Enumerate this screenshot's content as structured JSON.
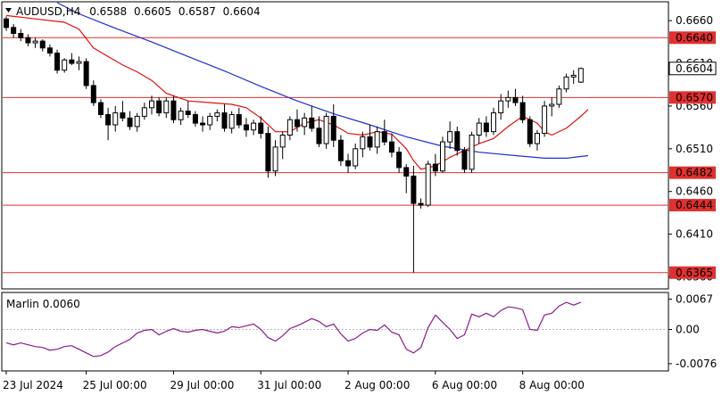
{
  "chart_data": {
    "type": "candlestick",
    "header": {
      "symbol": "AUDUSD,H4",
      "open": "0.6588",
      "high": "0.6605",
      "low": "0.6587",
      "close": "0.6604"
    },
    "price_axis": {
      "ylim": [
        0.6347,
        0.6681
      ],
      "ticks": [
        "0.6660",
        "0.6610",
        "0.6560",
        "0.6510",
        "0.6460",
        "0.6410",
        "0.6360"
      ]
    },
    "levels": [
      {
        "label": "0.6640",
        "value": 0.664
      },
      {
        "label": "0.6570",
        "value": 0.657
      },
      {
        "label": "0.6482",
        "value": 0.6482
      },
      {
        "label": "0.6444",
        "value": 0.6444
      },
      {
        "label": "0.6365",
        "value": 0.6365
      }
    ],
    "current_price": {
      "label": "0.6604",
      "value": 0.6604
    },
    "time_axis": {
      "labels": [
        {
          "text": "23 Jul 2024",
          "bar": 0
        },
        {
          "text": "25 Jul 00:00",
          "bar": 11
        },
        {
          "text": "29 Jul 00:00",
          "bar": 23
        },
        {
          "text": "31 Jul 00:00",
          "bar": 35
        },
        {
          "text": "2 Aug 00:00",
          "bar": 47
        },
        {
          "text": "6 Aug 00:00",
          "bar": 59
        },
        {
          "text": "8 Aug 00:00",
          "bar": 71
        }
      ]
    },
    "series_colors": {
      "bull": "#ffffff",
      "bear": "#000000",
      "wick": "#000000"
    },
    "candles": [
      [
        0.6662,
        0.6665,
        0.6648,
        0.6652
      ],
      [
        0.6652,
        0.6656,
        0.664,
        0.6645
      ],
      [
        0.6645,
        0.665,
        0.6636,
        0.664
      ],
      [
        0.664,
        0.6644,
        0.663,
        0.6634
      ],
      [
        0.6634,
        0.664,
        0.6628,
        0.6636
      ],
      [
        0.6636,
        0.6638,
        0.6624,
        0.6628
      ],
      [
        0.6628,
        0.6632,
        0.6618,
        0.6622
      ],
      [
        0.6622,
        0.6626,
        0.6598,
        0.6602
      ],
      [
        0.6602,
        0.6616,
        0.6599,
        0.6614
      ],
      [
        0.6614,
        0.6622,
        0.6608,
        0.661
      ],
      [
        0.661,
        0.6618,
        0.6602,
        0.6612
      ],
      [
        0.6612,
        0.6616,
        0.658,
        0.6584
      ],
      [
        0.6584,
        0.659,
        0.656,
        0.6564
      ],
      [
        0.6564,
        0.6568,
        0.6546,
        0.655
      ],
      [
        0.655,
        0.6558,
        0.652,
        0.6538
      ],
      [
        0.6538,
        0.656,
        0.653,
        0.6552
      ],
      [
        0.6552,
        0.6566,
        0.6542,
        0.6546
      ],
      [
        0.6546,
        0.6554,
        0.6532,
        0.6536
      ],
      [
        0.6536,
        0.6552,
        0.653,
        0.6548
      ],
      [
        0.6548,
        0.6564,
        0.6544,
        0.6558
      ],
      [
        0.6558,
        0.6572,
        0.655,
        0.6566
      ],
      [
        0.6566,
        0.657,
        0.6548,
        0.6552
      ],
      [
        0.6552,
        0.657,
        0.6546,
        0.6566
      ],
      [
        0.6566,
        0.6572,
        0.654,
        0.6544
      ],
      [
        0.6544,
        0.6558,
        0.6538,
        0.6554
      ],
      [
        0.6554,
        0.6566,
        0.6546,
        0.655
      ],
      [
        0.655,
        0.6554,
        0.6536,
        0.654
      ],
      [
        0.654,
        0.6548,
        0.653,
        0.6538
      ],
      [
        0.6538,
        0.6552,
        0.6532,
        0.6548
      ],
      [
        0.6548,
        0.6556,
        0.6542,
        0.6552
      ],
      [
        0.6552,
        0.6562,
        0.653,
        0.6534
      ],
      [
        0.6534,
        0.6554,
        0.6528,
        0.655
      ],
      [
        0.655,
        0.6558,
        0.6534,
        0.6538
      ],
      [
        0.6538,
        0.6546,
        0.6524,
        0.6532
      ],
      [
        0.6532,
        0.6544,
        0.6526,
        0.654
      ],
      [
        0.654,
        0.6548,
        0.6522,
        0.6528
      ],
      [
        0.6528,
        0.6536,
        0.6476,
        0.6484
      ],
      [
        0.6484,
        0.652,
        0.6478,
        0.6512
      ],
      [
        0.6512,
        0.653,
        0.6498,
        0.6526
      ],
      [
        0.6526,
        0.6548,
        0.652,
        0.6544
      ],
      [
        0.6544,
        0.6556,
        0.653,
        0.6536
      ],
      [
        0.6536,
        0.6552,
        0.6526,
        0.6546
      ],
      [
        0.6546,
        0.656,
        0.653,
        0.6534
      ],
      [
        0.6534,
        0.6548,
        0.6512,
        0.6516
      ],
      [
        0.6516,
        0.6552,
        0.651,
        0.6548
      ],
      [
        0.6548,
        0.6562,
        0.6512,
        0.652
      ],
      [
        0.652,
        0.6526,
        0.649,
        0.6496
      ],
      [
        0.6496,
        0.6504,
        0.6482,
        0.649
      ],
      [
        0.649,
        0.6516,
        0.6486,
        0.651
      ],
      [
        0.651,
        0.653,
        0.65,
        0.6524
      ],
      [
        0.6524,
        0.6538,
        0.6508,
        0.6512
      ],
      [
        0.6512,
        0.6536,
        0.6504,
        0.653
      ],
      [
        0.653,
        0.6544,
        0.6514,
        0.6518
      ],
      [
        0.6518,
        0.6528,
        0.65,
        0.6506
      ],
      [
        0.6506,
        0.6512,
        0.6482,
        0.6488
      ],
      [
        0.6488,
        0.6492,
        0.6458,
        0.6478
      ],
      [
        0.6478,
        0.649,
        0.6365,
        0.6446
      ],
      [
        0.6446,
        0.6452,
        0.644,
        0.6444
      ],
      [
        0.6444,
        0.6496,
        0.6442,
        0.6492
      ],
      [
        0.6492,
        0.6504,
        0.6478,
        0.6484
      ],
      [
        0.6484,
        0.6524,
        0.6482,
        0.6518
      ],
      [
        0.6518,
        0.6542,
        0.651,
        0.653
      ],
      [
        0.653,
        0.6536,
        0.6502,
        0.6508
      ],
      [
        0.6508,
        0.6512,
        0.6482,
        0.6486
      ],
      [
        0.6486,
        0.653,
        0.6482,
        0.6526
      ],
      [
        0.6526,
        0.6546,
        0.6516,
        0.654
      ],
      [
        0.654,
        0.6548,
        0.6524,
        0.653
      ],
      [
        0.653,
        0.6558,
        0.6526,
        0.6552
      ],
      [
        0.6552,
        0.6574,
        0.6544,
        0.6566
      ],
      [
        0.6566,
        0.6578,
        0.6558,
        0.657
      ],
      [
        0.657,
        0.658,
        0.656,
        0.6564
      ],
      [
        0.6564,
        0.6572,
        0.654,
        0.6544
      ],
      [
        0.6544,
        0.6548,
        0.6512,
        0.6516
      ],
      [
        0.6516,
        0.6532,
        0.6508,
        0.6528
      ],
      [
        0.6528,
        0.6566,
        0.6524,
        0.656
      ],
      [
        0.656,
        0.657,
        0.6548,
        0.6562
      ],
      [
        0.6562,
        0.6584,
        0.6558,
        0.658
      ],
      [
        0.658,
        0.6598,
        0.6576,
        0.6594
      ],
      [
        0.6594,
        0.6602,
        0.6586,
        0.6596
      ],
      [
        0.6588,
        0.6605,
        0.6587,
        0.6604
      ]
    ],
    "moving_averages": [
      {
        "color": "#1f2fd0",
        "points": [
          [
            7,
            0.6681
          ],
          [
            10,
            0.6668
          ],
          [
            15,
            0.6651
          ],
          [
            20,
            0.6635
          ],
          [
            25,
            0.6618
          ],
          [
            30,
            0.6601
          ],
          [
            35,
            0.6583
          ],
          [
            40,
            0.6566
          ],
          [
            45,
            0.6551
          ],
          [
            50,
            0.6538
          ],
          [
            55,
            0.6524
          ],
          [
            60,
            0.6513
          ],
          [
            65,
            0.6506
          ],
          [
            70,
            0.6502
          ],
          [
            74,
            0.6499
          ],
          [
            77,
            0.6499
          ],
          [
            80,
            0.6502
          ]
        ]
      },
      {
        "color": "#e01010",
        "points": [
          [
            0,
            0.6666
          ],
          [
            4,
            0.6662
          ],
          [
            8,
            0.6658
          ],
          [
            10,
            0.665
          ],
          [
            12,
            0.6628
          ],
          [
            14,
            0.6618
          ],
          [
            16,
            0.6608
          ],
          [
            18,
            0.66
          ],
          [
            20,
            0.659
          ],
          [
            22,
            0.6575
          ],
          [
            25,
            0.6566
          ],
          [
            28,
            0.6564
          ],
          [
            31,
            0.6562
          ],
          [
            33,
            0.6558
          ],
          [
            35,
            0.6546
          ],
          [
            37,
            0.653
          ],
          [
            39,
            0.653
          ],
          [
            41,
            0.654
          ],
          [
            43,
            0.6544
          ],
          [
            45,
            0.6538
          ],
          [
            47,
            0.6528
          ],
          [
            49,
            0.6526
          ],
          [
            51,
            0.653
          ],
          [
            53,
            0.6527
          ],
          [
            55,
            0.651
          ],
          [
            56,
            0.6496
          ],
          [
            57,
            0.6486
          ],
          [
            59,
            0.649
          ],
          [
            61,
            0.65
          ],
          [
            63,
            0.6508
          ],
          [
            65,
            0.6516
          ],
          [
            67,
            0.6522
          ],
          [
            69,
            0.6536
          ],
          [
            71,
            0.6548
          ],
          [
            73,
            0.654
          ],
          [
            74,
            0.653
          ],
          [
            75,
            0.6526
          ],
          [
            77,
            0.6534
          ],
          [
            79,
            0.6548
          ],
          [
            80,
            0.6556
          ]
        ]
      }
    ],
    "indicator": {
      "label": "Marlin 0.0060",
      "ylim": [
        -0.009,
        0.008
      ],
      "ticks": [
        "0.0067",
        "0.00",
        "-0.0076"
      ],
      "zero_line": 0,
      "color": "#8b1a8b",
      "values": [
        -0.003,
        -0.0034,
        -0.003,
        -0.0034,
        -0.0038,
        -0.004,
        -0.0046,
        -0.0044,
        -0.0038,
        -0.0036,
        -0.0044,
        -0.0052,
        -0.006,
        -0.0058,
        -0.005,
        -0.0038,
        -0.003,
        -0.0022,
        -0.0008,
        -0.0002,
        0.0,
        -0.0012,
        -0.0004,
        0.0002,
        -0.0004,
        -0.0006,
        -0.0002,
        0.0,
        -0.0004,
        -0.0008,
        -0.0004,
        0.0006,
        0.0004,
        0.0008,
        0.0012,
        0.0,
        -0.0018,
        -0.0026,
        -0.0014,
        0.0002,
        0.0008,
        0.0016,
        0.0024,
        0.0018,
        0.0006,
        0.0012,
        -0.001,
        -0.0026,
        -0.002,
        -0.0008,
        0.0,
        -0.0002,
        0.001,
        -0.0006,
        -0.0012,
        -0.0044,
        -0.0052,
        -0.004,
        0.0004,
        0.0032,
        0.0016,
        0.0,
        -0.002,
        -0.0012,
        0.0034,
        0.0028,
        0.0036,
        0.0028,
        0.0042,
        0.005,
        0.0048,
        0.0044,
        0.0,
        -0.0002,
        0.0032,
        0.0036,
        0.0052,
        0.006,
        0.0054,
        0.006
      ]
    }
  }
}
